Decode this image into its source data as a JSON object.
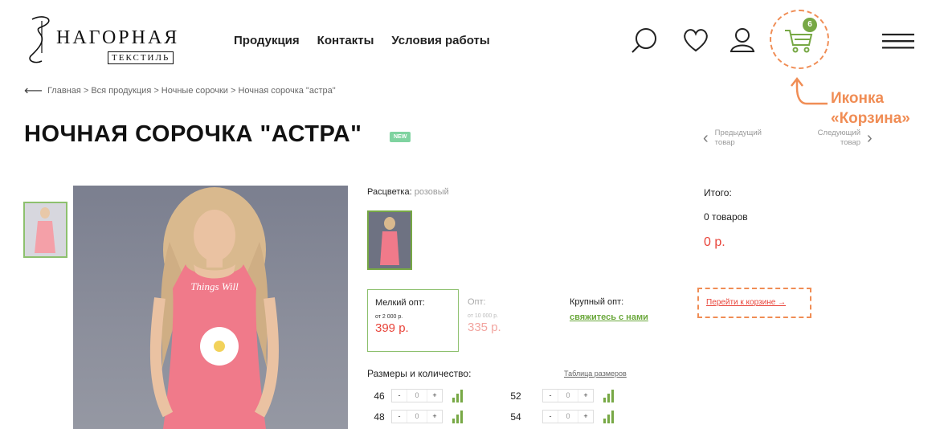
{
  "brand": {
    "name": "НАГОРНАЯ",
    "sub": "ТЕКСТИЛЬ"
  },
  "nav": {
    "items": [
      "Продукция",
      "Контакты",
      "Условия работы"
    ]
  },
  "header": {
    "cart_count": "6"
  },
  "annotation": {
    "line1": "Иконка",
    "line2": "«Корзина»"
  },
  "breadcrumb": {
    "text": "Главная > Вся продукция > Ночные сорочки > Ночная сорочка \"астра\""
  },
  "product": {
    "title": "НОЧНАЯ СОРОЧКА \"АСТРА\"",
    "badge": "NEW",
    "colour_label": "Расцветка:",
    "colour_value": "розовый"
  },
  "pager": {
    "prev": "Предыдущий товар",
    "next": "Следующий товар"
  },
  "prices": {
    "small": {
      "label": "Мелкий опт:",
      "from": "от 2 000 р.",
      "value": "399 р."
    },
    "opt": {
      "label": "Опт:",
      "from": "от 10 000 р.",
      "value": "335 р."
    },
    "large": {
      "label": "Крупный опт:",
      "link": "свяжитесь с нами"
    }
  },
  "sizes": {
    "title": "Размеры и количество:",
    "table_link": "Таблица размеров",
    "rows": [
      {
        "size": "46",
        "qty": "0"
      },
      {
        "size": "52",
        "qty": "0"
      },
      {
        "size": "48",
        "qty": "0"
      },
      {
        "size": "54",
        "qty": "0"
      }
    ],
    "minus": "-",
    "plus": "+"
  },
  "summary": {
    "total_label": "Итого:",
    "count": "0 товаров",
    "price": "0 р.",
    "cart_link": "Перейти к корзине →"
  },
  "colors": {
    "accent": "#77a845",
    "price": "#e8443a",
    "annotation": "#f08d55"
  }
}
